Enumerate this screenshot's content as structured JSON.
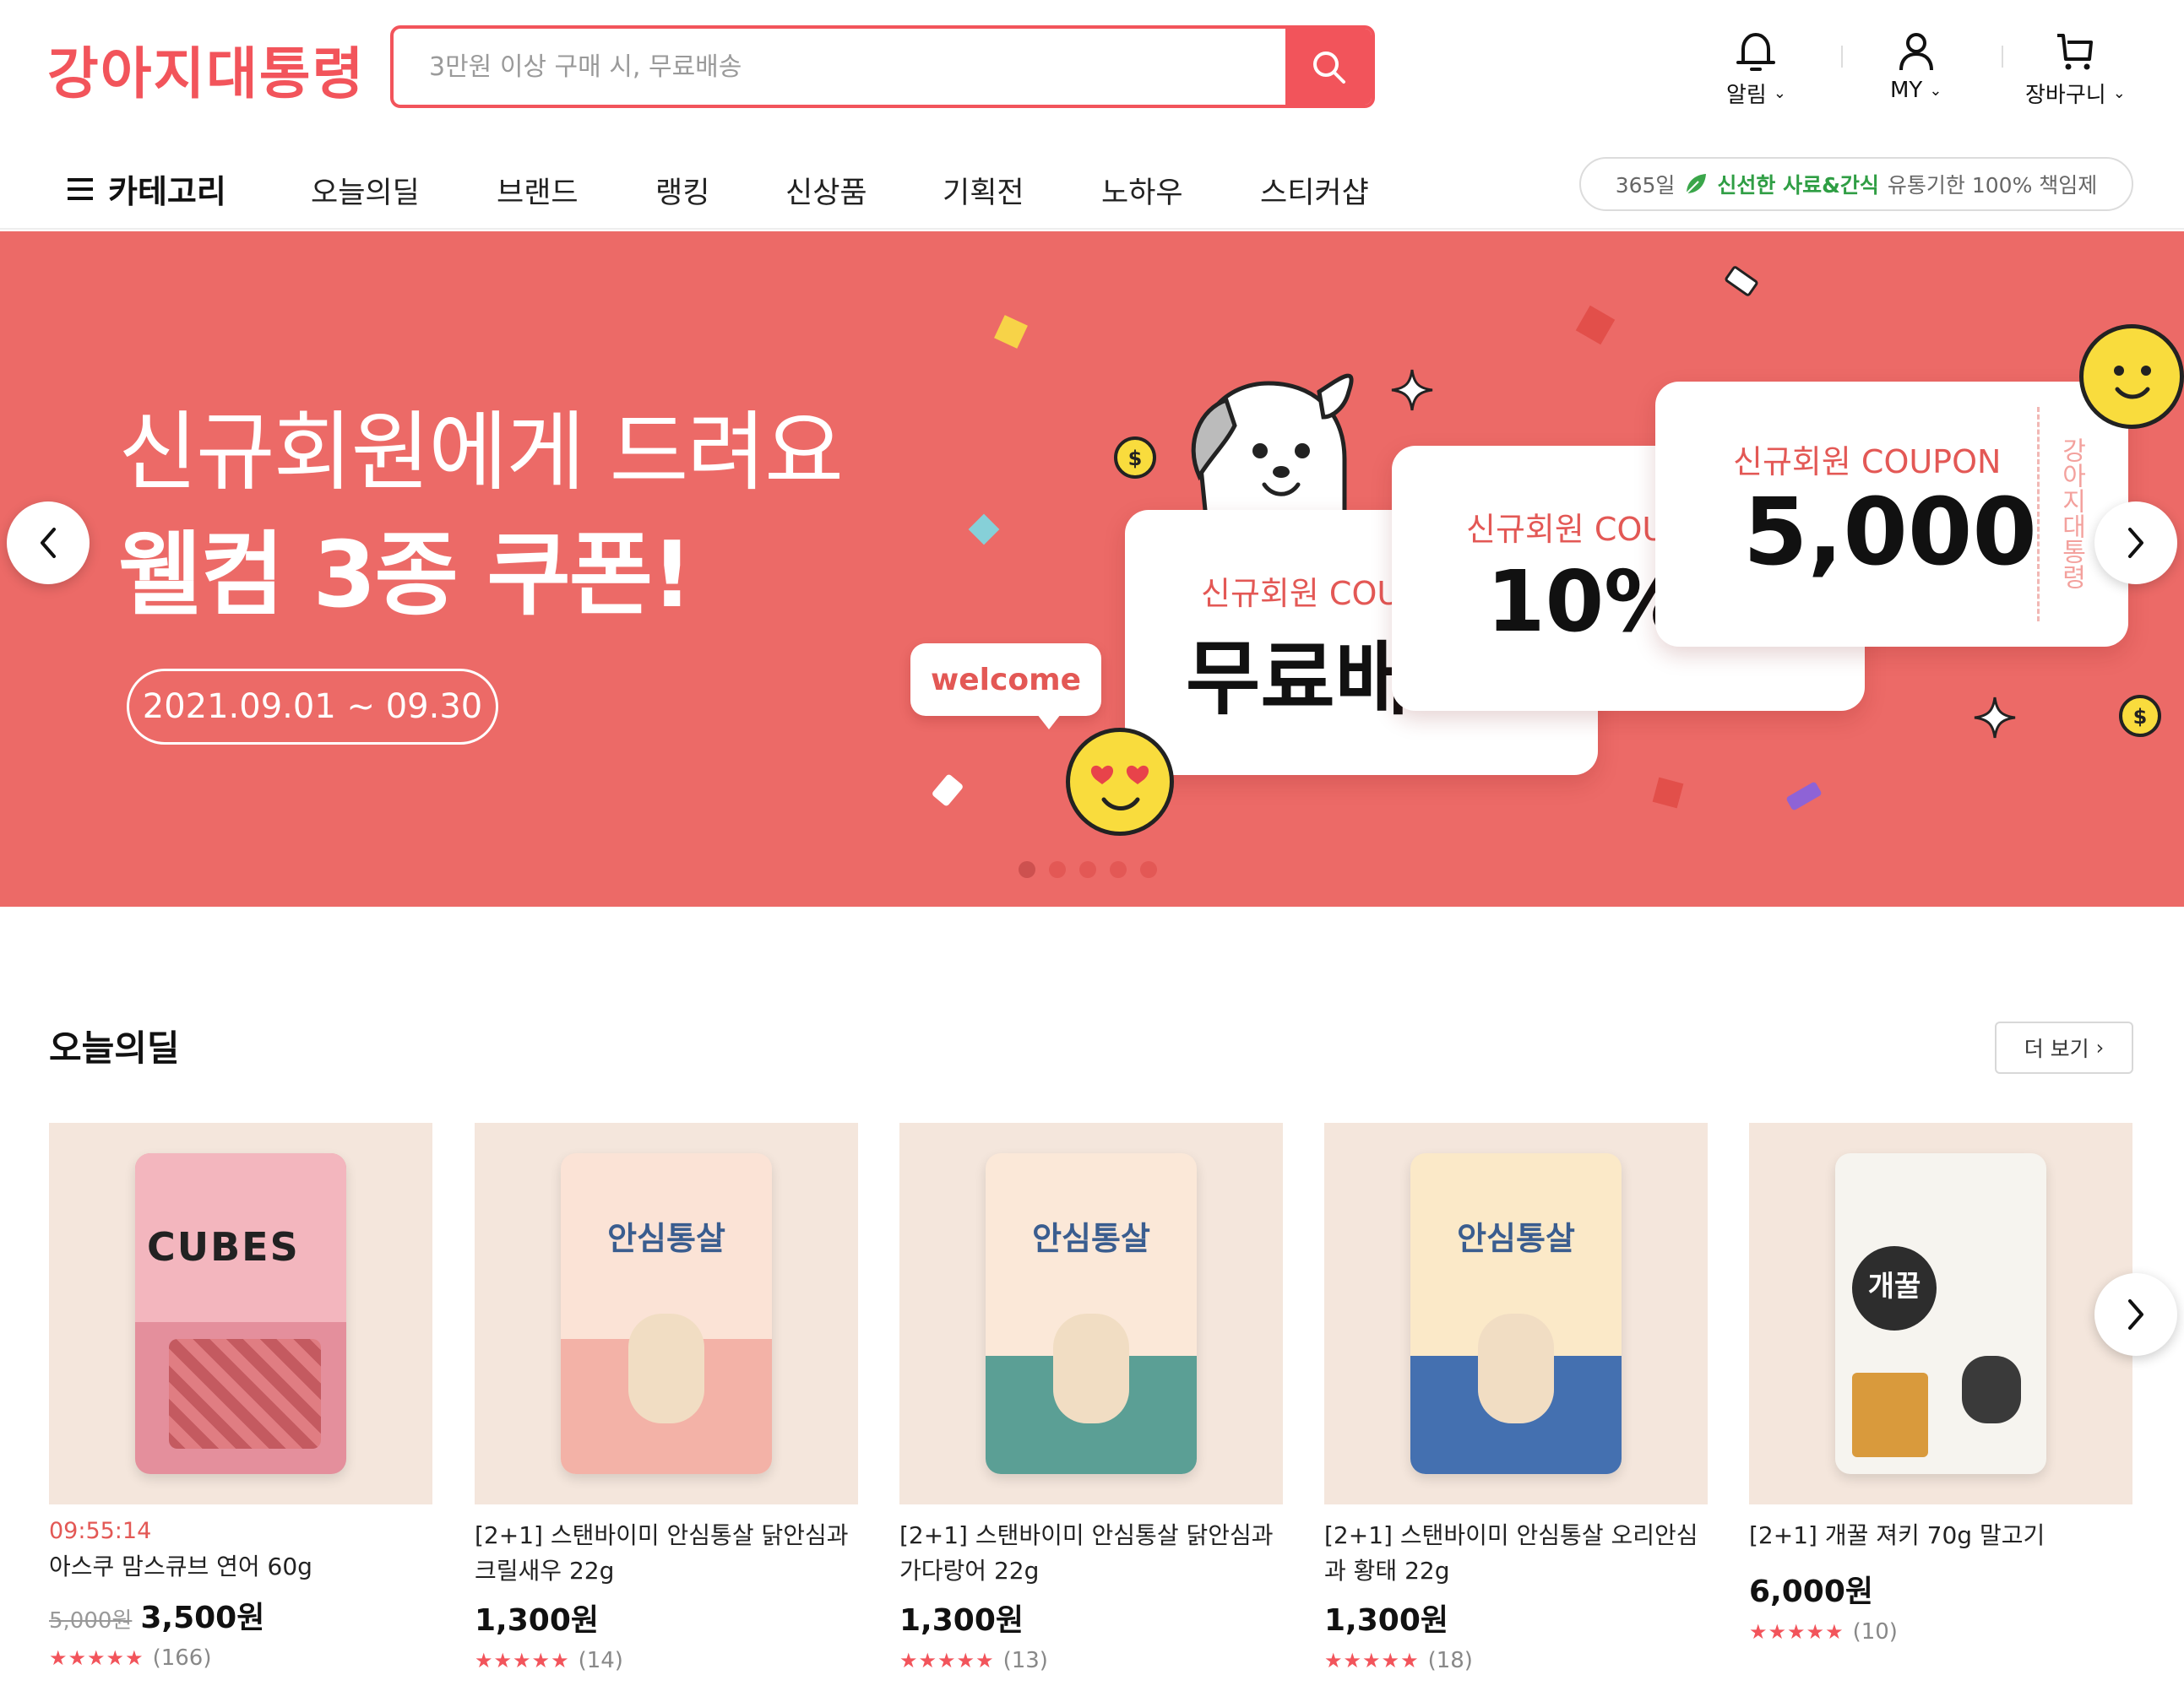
{
  "header": {
    "logo": "강아지대통령",
    "search_placeholder": "3만원 이상 구매 시, 무료배송",
    "alarm": "알림",
    "my": "MY",
    "cart": "장바구니"
  },
  "nav": {
    "category": "카테고리",
    "items": [
      "오늘의딜",
      "브랜드",
      "랭킹",
      "신상품",
      "기획전",
      "노하우",
      "스티커샵"
    ],
    "fresh_badge": {
      "days": "365일",
      "highlight": "신선한 사료&간식",
      "rest": "유통기한 100% 책임제"
    }
  },
  "banner": {
    "headline": "신규회원에게 드려요",
    "subheadline": "웰컴 3종 쿠폰!",
    "period": "2021.09.01 ~ 09.30",
    "welcome": "welcome",
    "coupons": [
      {
        "title": "신규회원 COUP",
        "value": "무료배"
      },
      {
        "title": "신규회원 COUP",
        "value": "10%"
      },
      {
        "title": "신규회원 COUPON",
        "value": "5,000",
        "side": "강아지대통령"
      }
    ],
    "active_slide": 1,
    "slide_count": 5
  },
  "deal": {
    "title": "오늘의딜",
    "more": "더 보기",
    "products": [
      {
        "timer": "09:55:14",
        "name": "아스쿠 맘스큐브 연어 60g",
        "orig_price": "5,000원",
        "price": "3,500원",
        "stars": "★★★★★",
        "reviews": "(166)",
        "pack_label": "CUBES",
        "pack_color": "#e48f9c"
      },
      {
        "name": "[2+1] 스탠바이미 안심통살 닭안심과 크릴새우 22g",
        "price": "1,300원",
        "stars": "★★★★★",
        "reviews": "(14)",
        "pack_label": "안심통살",
        "pack_color": "#f3b2a7"
      },
      {
        "name": "[2+1] 스탠바이미 안심통살 닭안심과 가다랑어 22g",
        "price": "1,300원",
        "stars": "★★★★★",
        "reviews": "(13)",
        "pack_label": "안심통살",
        "pack_color": "#a9cfc5"
      },
      {
        "name": "[2+1] 스탠바이미 안심통살 오리안심과 황태 22g",
        "price": "1,300원",
        "stars": "★★★★★",
        "reviews": "(18)",
        "pack_label": "안심통살",
        "pack_color": "#9ec2e0"
      },
      {
        "name": "[2+1] 개꿀 져키 70g 말고기",
        "price": "6,000원",
        "stars": "★★★★★",
        "reviews": "(10)",
        "pack_label": "개꿀",
        "pack_color": "#3b3b3b"
      }
    ]
  }
}
